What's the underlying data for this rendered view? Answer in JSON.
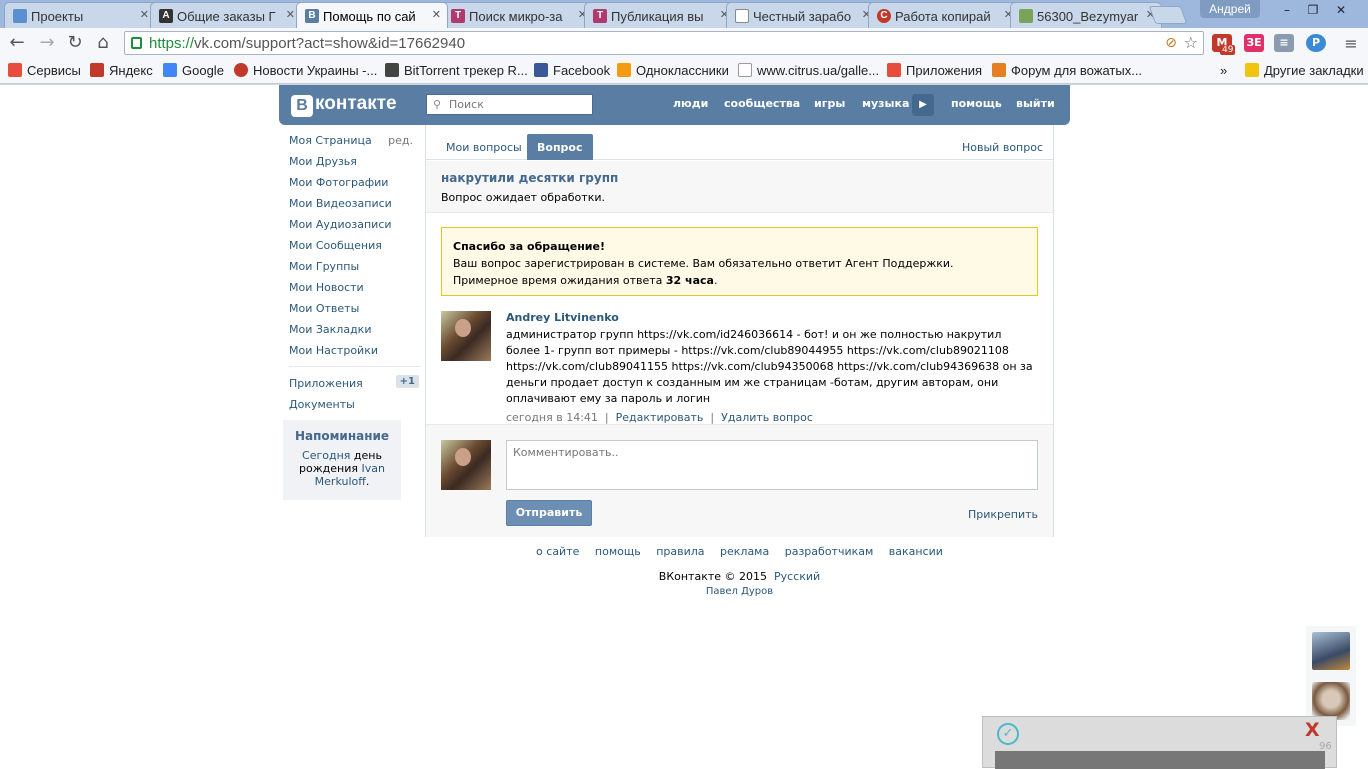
{
  "browser": {
    "tabs": [
      {
        "title": "Проекты",
        "icon": "blue-dot"
      },
      {
        "title": "Общие заказы Г",
        "icon": "letter-a"
      },
      {
        "title": "Помощь по сай",
        "icon": "vk-logo",
        "active": true
      },
      {
        "title": "Поиск микро-за",
        "icon": "tt-logo"
      },
      {
        "title": "Публикация вы",
        "icon": "tt-logo"
      },
      {
        "title": "Честный зарабо",
        "icon": "page"
      },
      {
        "title": "Работа копирай",
        "icon": "copyright-logo"
      },
      {
        "title": "56300_Bezymyar",
        "icon": "image"
      }
    ],
    "user": "Андрей",
    "url_scheme": "https://",
    "url_rest": "vk.com/support?act=show&id=17662940",
    "mail_count": "49",
    "bookmarks": [
      {
        "label": "Сервисы",
        "color": "#e74c3c"
      },
      {
        "label": "Яндекс",
        "color": "#c0392b"
      },
      {
        "label": "Google",
        "color": "#4285f4"
      },
      {
        "label": "Новости Украины -...",
        "color": "#c0392b"
      },
      {
        "label": "BitTorrent трекер R...",
        "color": "#444"
      },
      {
        "label": "Facebook",
        "color": "#3b5998"
      },
      {
        "label": "Одноклассники",
        "color": "#f39c12"
      },
      {
        "label": "www.citrus.ua/galle...",
        "color": "#ddd"
      },
      {
        "label": "Приложения",
        "color": "#e74c3c"
      },
      {
        "label": "Форум для вожатых...",
        "color": "#e67e22"
      }
    ],
    "bookmarks_more": "»",
    "other_bookmarks": "Другие закладки"
  },
  "vk": {
    "logo": "контакте",
    "logo_letter": "В",
    "search_placeholder": "Поиск",
    "nav": [
      "люди",
      "сообщества",
      "игры",
      "музыка",
      "помощь",
      "выйти"
    ]
  },
  "sidebar": {
    "items": [
      {
        "label": "Моя Страница",
        "extra": "ред."
      },
      {
        "label": "Мои Друзья"
      },
      {
        "label": "Мои Фотографии"
      },
      {
        "label": "Мои Видеозаписи"
      },
      {
        "label": "Мои Аудиозаписи"
      },
      {
        "label": "Мои Сообщения"
      },
      {
        "label": "Мои Группы"
      },
      {
        "label": "Мои Новости"
      },
      {
        "label": "Мои Ответы"
      },
      {
        "label": "Мои Закладки"
      },
      {
        "label": "Мои Настройки"
      }
    ],
    "items2": [
      {
        "label": "Приложения",
        "count": "+1"
      },
      {
        "label": "Документы"
      }
    ],
    "reminder": {
      "title": "Напоминание",
      "today": "Сегодня",
      "text1": " день рождения ",
      "name": "Ivan Merkuloff",
      "end": "."
    }
  },
  "content": {
    "tabs": [
      "Мои вопросы",
      "Вопрос"
    ],
    "new_question": "Новый вопрос",
    "question_title": "накрутили десятки групп",
    "question_status": "Вопрос ожидает обработки.",
    "notice": {
      "title": "Спасибо за обращение!",
      "line1": "Ваш вопрос зарегистрирован в системе. Вам обязательно ответит Агент Поддержки.",
      "line2_pre": "Примерное время ожидания ответа ",
      "line2_bold": "32 часа",
      "line2_post": "."
    },
    "post": {
      "author": "Andrey Litvinenko",
      "text": "администратор групп https://vk.com/id246036614 - бот! и он же полностью накрутил более 1- групп вот примеры - https://vk.com/club89044955 https://vk.com/club89021108 https://vk.com/club89041155 https://vk.com/club94350068 https://vk.com/club94369638 он за деньги продает доступ к созданным им же страницам -ботам, другим авторам, они оплачивают ему за пароль и логин",
      "time": "сегодня в 14:41",
      "edit": "Редактировать",
      "delete": "Удалить вопрос",
      "sep": "|"
    },
    "comment_placeholder": "Комментировать..",
    "send": "Отправить",
    "attach": "Прикрепить"
  },
  "footer": {
    "links": [
      "о сайте",
      "помощь",
      "правила",
      "реклама",
      "разработчикам",
      "вакансии"
    ],
    "copyright": "ВКонтакте © 2015",
    "language": "Русский",
    "author": "Павел Дуров"
  },
  "popup": {
    "count": "96"
  }
}
